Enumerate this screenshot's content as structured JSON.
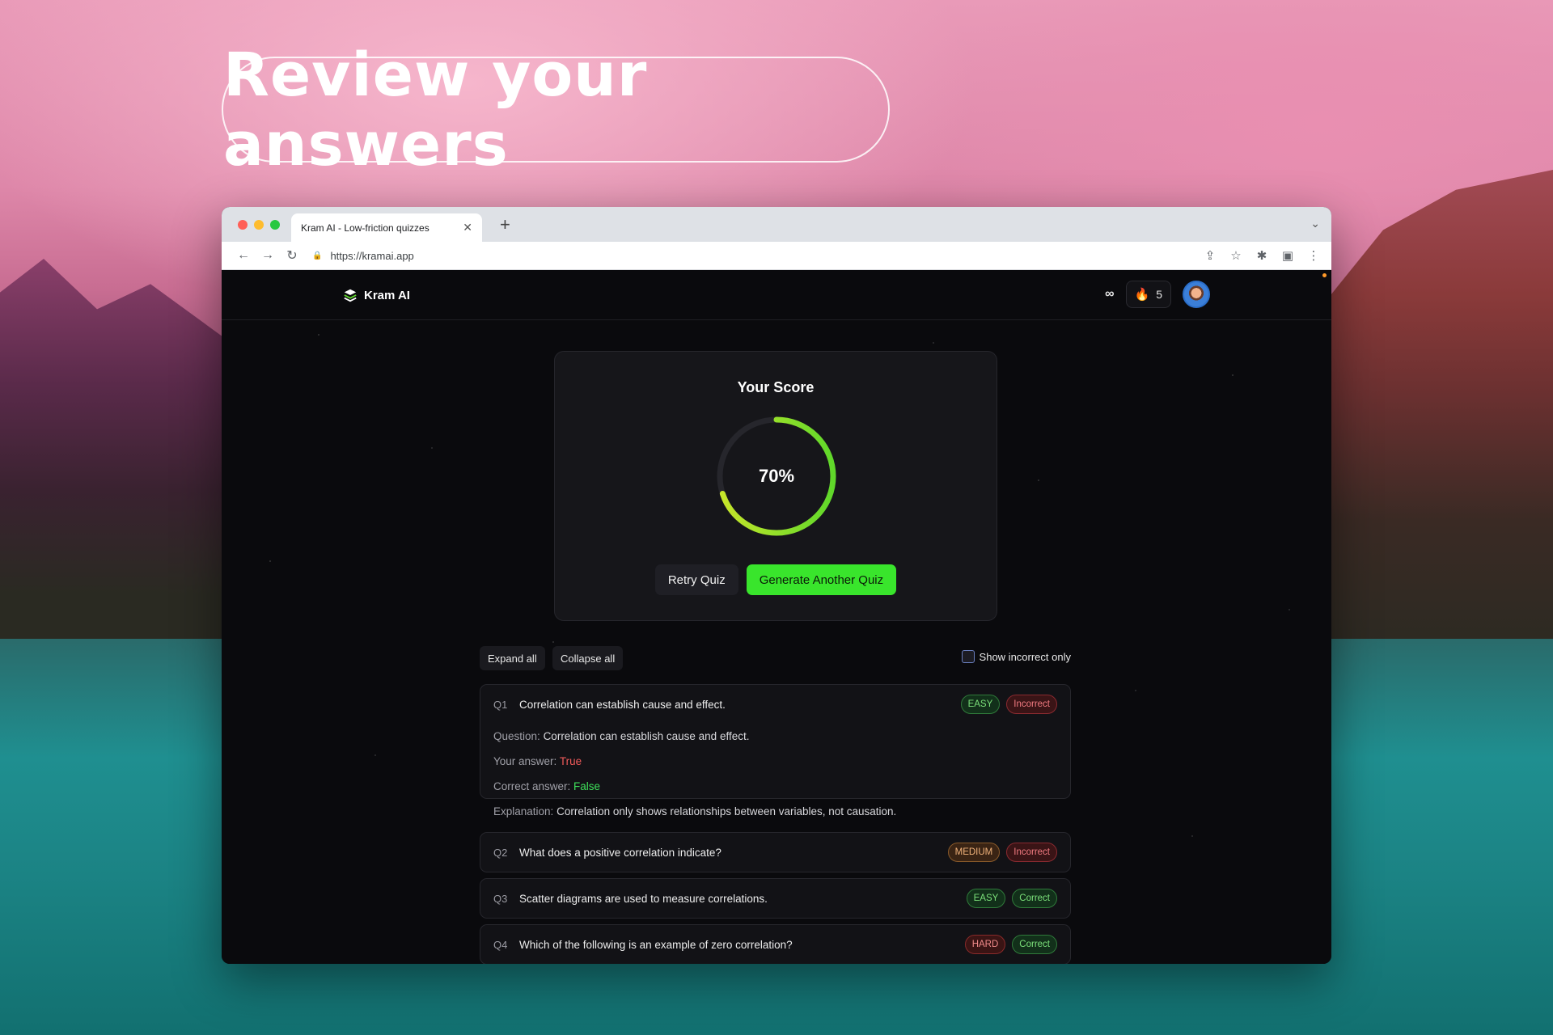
{
  "headline": "Review your answers",
  "browser": {
    "tab_title": "Kram AI - Low-friction quizzes",
    "url": "https://kramai.app"
  },
  "app": {
    "brand": "Kram AI",
    "infinity": "∞",
    "streak_count": "5"
  },
  "score": {
    "title": "Your Score",
    "percent_label": "70%",
    "percent_value": 70,
    "retry_label": "Retry Quiz",
    "generate_label": "Generate Another Quiz"
  },
  "controls": {
    "expand_all": "Expand all",
    "collapse_all": "Collapse all",
    "show_incorrect": "Show incorrect only"
  },
  "questions": [
    {
      "num": "Q1",
      "text": "Correlation can establish cause and effect.",
      "difficulty": "EASY",
      "status": "Incorrect",
      "question_label": "Question:",
      "question_value": "Correlation can establish cause and effect.",
      "your_answer_label": "Your answer:",
      "your_answer_value": "True",
      "correct_answer_label": "Correct answer:",
      "correct_answer_value": "False",
      "explanation_label": "Explanation:",
      "explanation_value": "Correlation only shows relationships between variables, not causation."
    },
    {
      "num": "Q2",
      "text": "What does a positive correlation indicate?",
      "difficulty": "MEDIUM",
      "status": "Incorrect"
    },
    {
      "num": "Q3",
      "text": "Scatter diagrams are used to measure correlations.",
      "difficulty": "EASY",
      "status": "Correct"
    },
    {
      "num": "Q4",
      "text": "Which of the following is an example of zero correlation?",
      "difficulty": "HARD",
      "status": "Correct"
    }
  ],
  "colors": {
    "accent_green": "#39e52c",
    "ring_start": "#c8e62a",
    "ring_end": "#5fd82a",
    "incorrect": "#f05a5a"
  }
}
